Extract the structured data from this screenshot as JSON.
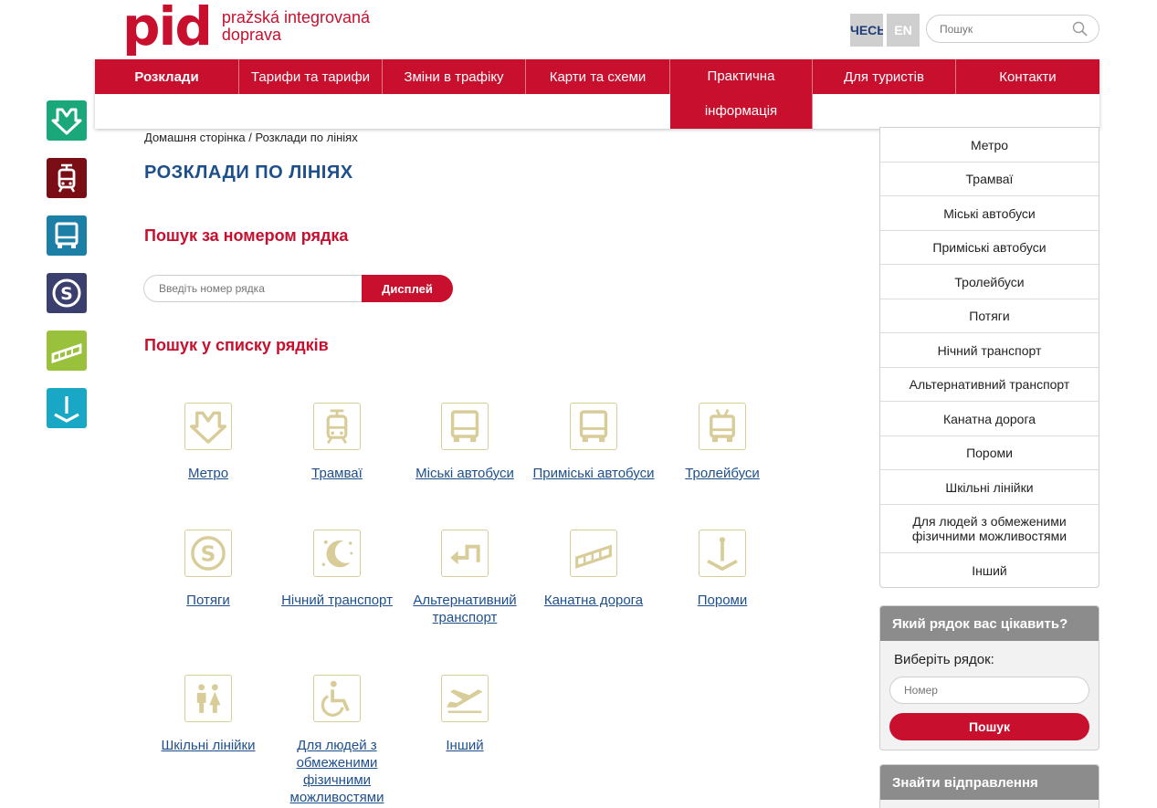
{
  "header": {
    "logo_mark": "pid",
    "logo_line1": "pražská integrovaná",
    "logo_line2": "doprava",
    "lang_cz": "ЧЕСЬКА",
    "lang_en": "EN",
    "search_placeholder": "Пошук"
  },
  "nav": {
    "items": [
      {
        "label": "Розклади"
      },
      {
        "label": "Тарифи та тарифи"
      },
      {
        "label": "Зміни в трафіку"
      },
      {
        "label": "Карти та схеми"
      },
      {
        "label": "Практична інформація"
      },
      {
        "label": "Для туристів"
      },
      {
        "label": "Контакти"
      }
    ]
  },
  "side_icons": [
    {
      "name": "metro",
      "color": "#1aa779"
    },
    {
      "name": "tram",
      "color": "#7a0e15"
    },
    {
      "name": "bus",
      "color": "#1b7fa6"
    },
    {
      "name": "train",
      "color": "#3a3f6e"
    },
    {
      "name": "funicular",
      "color": "#99c13c"
    },
    {
      "name": "ferry",
      "color": "#18a7c4"
    }
  ],
  "main": {
    "breadcrumb": "Домашня сторінка / Розклади по лініях",
    "title": "РОЗКЛАДИ ПО ЛІНІЯХ",
    "search_by_number": "Пошук за номером рядка",
    "search_placeholder": "Введіть номер рядка",
    "display_button": "Дисплей",
    "search_in_list": "Пошук у списку рядків",
    "tiles": [
      {
        "label": "Метро"
      },
      {
        "label": "Трамваї"
      },
      {
        "label": "Міські автобуси"
      },
      {
        "label": "Приміські автобуси"
      },
      {
        "label": "Тролейбуси"
      },
      {
        "label": "Потяги"
      },
      {
        "label": "Нічний транспорт"
      },
      {
        "label": "Альтернативний транспорт"
      },
      {
        "label": "Канатна дорога"
      },
      {
        "label": "Пороми"
      },
      {
        "label": "Шкільні лінійки"
      },
      {
        "label": "Для людей з обмеженими фізичними можливостями"
      },
      {
        "label": "Інший"
      }
    ]
  },
  "sidebar": {
    "items": [
      {
        "label": "Метро"
      },
      {
        "label": "Трамваї"
      },
      {
        "label": "Міські автобуси"
      },
      {
        "label": "Приміські автобуси"
      },
      {
        "label": "Тролейбуси"
      },
      {
        "label": "Потяги"
      },
      {
        "label": "Нічний транспорт"
      },
      {
        "label": "Альтернативний транспорт"
      },
      {
        "label": "Канатна дорога"
      },
      {
        "label": "Пороми"
      },
      {
        "label": "Шкільні лінійки"
      },
      {
        "label": "Для людей з обмеженими фізичними можливостями"
      },
      {
        "label": "Інший"
      }
    ],
    "widget1": {
      "title": "Який рядок вас цікавить?",
      "label": "Виберіть рядок:",
      "placeholder": "Номер",
      "button": "Пошук"
    },
    "widget2": {
      "title": "Знайти відправлення"
    }
  },
  "colors": {
    "brand_red": "#c8102e",
    "title_blue": "#1d4f8c",
    "tile_gold": "#d8cc99"
  }
}
